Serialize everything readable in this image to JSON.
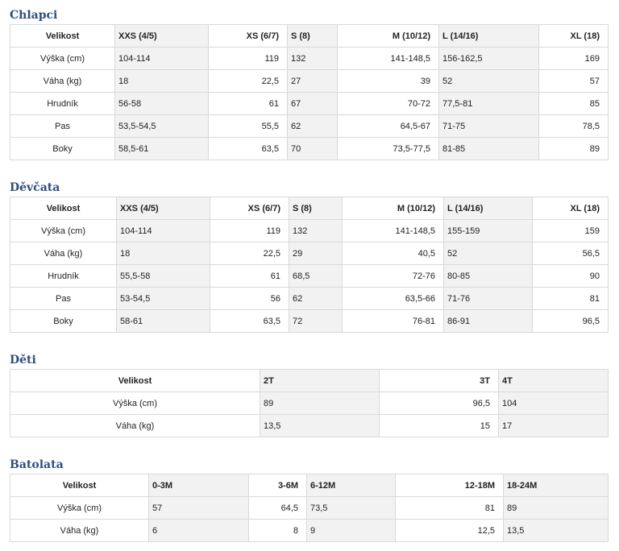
{
  "chlapci": {
    "title": "Chlapci",
    "header": [
      "Velikost",
      "XXS (4/5)",
      "XS (6/7)",
      "S (8)",
      "M (10/12)",
      "L (14/16)",
      "XL (18)"
    ],
    "rows": [
      [
        "Výška (cm)",
        "104-114",
        "119",
        "132",
        "141-148,5",
        "156-162,5",
        "169"
      ],
      [
        "Váha (kg)",
        "18",
        "22,5",
        "27",
        "39",
        "52",
        "57"
      ],
      [
        "Hrudník",
        "56-58",
        "61",
        "67",
        "70-72",
        "77,5-81",
        "85"
      ],
      [
        "Pas",
        "53,5-54,5",
        "55,5",
        "62",
        "64,5-67",
        "71-75",
        "78,5"
      ],
      [
        "Boky",
        "58,5-61",
        "63,5",
        "70",
        "73,5-77,5",
        "81-85",
        "89"
      ]
    ]
  },
  "divcata": {
    "title": "Děvčata",
    "header": [
      "Velikost",
      "XXS (4/5)",
      "XS (6/7)",
      "S (8)",
      "M (10/12)",
      "L (14/16)",
      "XL (18)"
    ],
    "rows": [
      [
        "Výška (cm)",
        "104-114",
        "119",
        "132",
        "141-148,5",
        "155-159",
        "159"
      ],
      [
        "Váha (kg)",
        "18",
        "22,5",
        "29",
        "40,5",
        "52",
        "56,5"
      ],
      [
        "Hrudník",
        "55,5-58",
        "61",
        "68,5",
        "72-76",
        "80-85",
        "90"
      ],
      [
        "Pas",
        "53-54,5",
        "56",
        "62",
        "63,5-66",
        "71-76",
        "81"
      ],
      [
        "Boky",
        "58-61",
        "63,5",
        "72",
        "76-81",
        "86-91",
        "96,5"
      ]
    ]
  },
  "deti": {
    "title": "Děti",
    "header": [
      "Velikost",
      "2T",
      "3T",
      "4T"
    ],
    "rows": [
      [
        "Výška (cm)",
        "89",
        "96,5",
        "104"
      ],
      [
        "Váha (kg)",
        "13,5",
        "15",
        "17"
      ]
    ]
  },
  "batolata": {
    "title": "Batolata",
    "header": [
      "Velikost",
      "0-3M",
      "3-6M",
      "6-12M",
      "12-18M",
      "18-24M"
    ],
    "rows": [
      [
        "Výška (cm)",
        "57",
        "64,5",
        "73,5",
        "81",
        "89"
      ],
      [
        "Váha (kg)",
        "6",
        "8",
        "9",
        "12,5",
        "13,5"
      ]
    ]
  }
}
